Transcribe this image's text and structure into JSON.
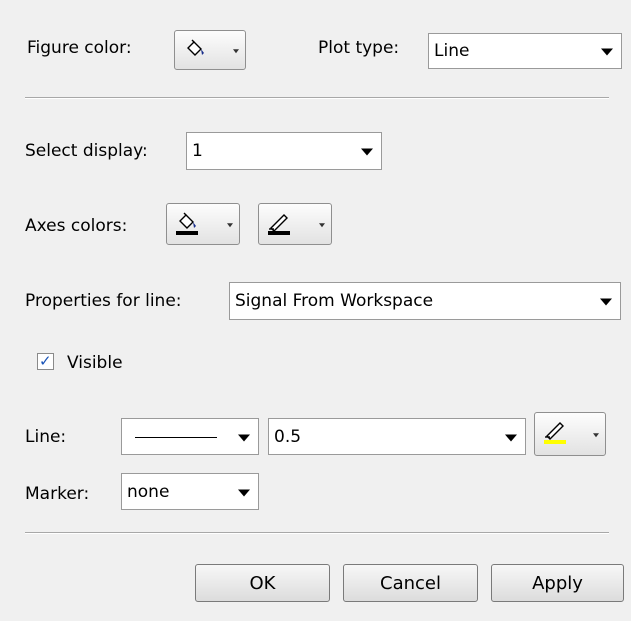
{
  "figure": {
    "color_label": "Figure color:",
    "color_icon": "paint-bucket-icon",
    "plot_type_label": "Plot type:",
    "plot_type_value": "Line"
  },
  "display": {
    "label": "Select display:",
    "value": "1"
  },
  "axes": {
    "label": "Axes colors:",
    "fill_icon": "paint-bucket-icon",
    "line_icon": "line-color-icon"
  },
  "line_props": {
    "label": "Properties for line:",
    "value": "Signal From Workspace"
  },
  "visible": {
    "label": "Visible",
    "checked": true,
    "check_mark": "✓"
  },
  "line": {
    "label": "Line:",
    "width_value": "0.5",
    "color_icon": "line-color-icon",
    "color_swatch": "#ffff00"
  },
  "marker": {
    "label": "Marker:",
    "value": "none"
  },
  "buttons": {
    "ok": "OK",
    "cancel": "Cancel",
    "apply": "Apply"
  }
}
